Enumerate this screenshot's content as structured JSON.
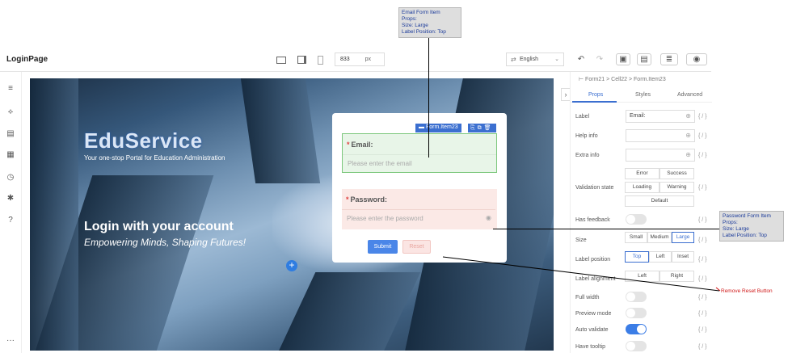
{
  "app": {
    "title": "LoginPage"
  },
  "toolbar": {
    "width_value": "833",
    "width_unit": "px",
    "language": "English",
    "language_glyph": "⇄",
    "icons": [
      "desktop-icon",
      "tablet-icon",
      "mobile-icon",
      "undo-icon",
      "redo-icon",
      "save-icon",
      "save-as-icon",
      "format-icon",
      "preview-icon"
    ]
  },
  "left_rail": {
    "icons": [
      "outline-icon",
      "components-icon",
      "data-source-icon",
      "template-icon",
      "history-icon",
      "bug-icon",
      "help-icon",
      "more-icon"
    ]
  },
  "canvas": {
    "brand": "EduService",
    "brand_tagline": "Your one-stop Portal for Education Administration",
    "hero_title": "Login with your account",
    "hero_subtitle": "Empowering Minds, Shaping Futures!",
    "add_button": "+"
  },
  "form": {
    "selected_tag": "Form.Item23",
    "selected_tools": "⎘⧉🗑",
    "email_label": "Email:",
    "email_placeholder": "Please enter the email",
    "password_label": "Password:",
    "password_placeholder": "Please enter the password",
    "required_mark": "*",
    "submit_label": "Submit",
    "reset_label": "Reset"
  },
  "panel": {
    "breadcrumb": [
      "Form21",
      "Cell22",
      "Form.Item23"
    ],
    "breadcrumb_sep": ">",
    "tabs": [
      "Props",
      "Styles",
      "Advanced"
    ],
    "active_tab": "Props",
    "fx": "{ / }",
    "rows": {
      "label": {
        "label": "Label",
        "value": "Email:"
      },
      "help_info": {
        "label": "Help info"
      },
      "extra_info": {
        "label": "Extra info"
      },
      "validation_state": {
        "label": "Validation state",
        "options": [
          "Error",
          "Success",
          "Loading",
          "Warning",
          "Default"
        ]
      },
      "has_feedback": {
        "label": "Has feedback",
        "on": false
      },
      "size": {
        "label": "Size",
        "options": [
          "Small",
          "Medium",
          "Large"
        ],
        "selected": "Large"
      },
      "label_position": {
        "label": "Label position",
        "options": [
          "Top",
          "Left",
          "Inset"
        ],
        "selected": "Top"
      },
      "label_alignment": {
        "label": "Label alignment",
        "options": [
          "Left",
          "Right"
        ]
      },
      "full_width": {
        "label": "Full width",
        "on": false
      },
      "preview_mode": {
        "label": "Preview mode",
        "on": false
      },
      "auto_validate": {
        "label": "Auto validate",
        "on": true
      },
      "have_tooltip": {
        "label": "Have tooltip",
        "on": false
      }
    }
  },
  "annotations": {
    "email_note": [
      "Email Form Item",
      "Props:",
      "Size: Large",
      "Label Position: Top"
    ],
    "password_note": [
      "Password Form Item",
      "Props:",
      "Size: Large",
      "Label Position: Top"
    ],
    "reset_note": "Remove Reset Button"
  }
}
